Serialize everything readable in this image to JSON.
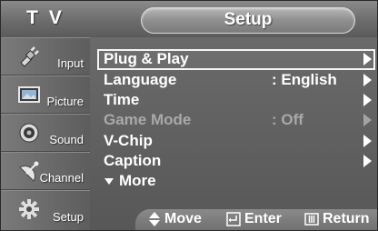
{
  "header": {
    "left_title": "T V",
    "title": "Setup"
  },
  "sidebar": {
    "items": [
      {
        "label": "Input",
        "icon": "input-plug-icon"
      },
      {
        "label": "Picture",
        "icon": "picture-icon"
      },
      {
        "label": "Sound",
        "icon": "sound-speaker-icon"
      },
      {
        "label": "Channel",
        "icon": "channel-satellite-icon"
      },
      {
        "label": "Setup",
        "icon": "setup-gear-icon"
      }
    ]
  },
  "menu": {
    "items": [
      {
        "label": "Plug & Play",
        "value": "",
        "selected": true,
        "enabled": true
      },
      {
        "label": "Language",
        "value": ": English",
        "selected": false,
        "enabled": true
      },
      {
        "label": "Time",
        "value": "",
        "selected": false,
        "enabled": true
      },
      {
        "label": "Game Mode",
        "value": ": Off",
        "selected": false,
        "enabled": false
      },
      {
        "label": "V-Chip",
        "value": "",
        "selected": false,
        "enabled": true
      },
      {
        "label": "Caption",
        "value": "",
        "selected": false,
        "enabled": true
      }
    ],
    "more_label": "More"
  },
  "footer": {
    "move_label": "Move",
    "enter_label": "Enter",
    "return_label": "Return"
  },
  "colors": {
    "background": "#5f5f5f",
    "text": "#ffffff",
    "disabled_text": "#a9a9a9",
    "selection_border": "#f4f4f4"
  }
}
